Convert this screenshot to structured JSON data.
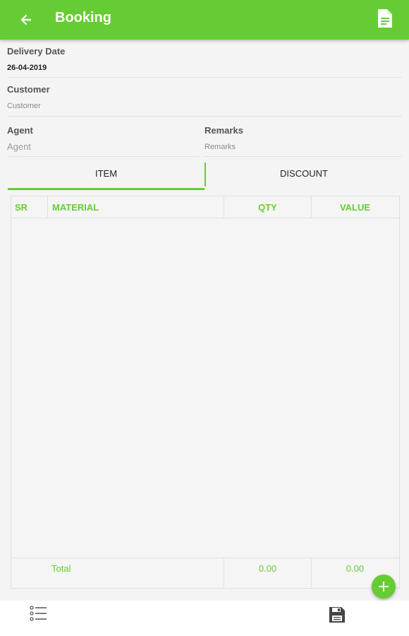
{
  "appbar": {
    "title": "Booking",
    "back_icon": "arrow-left-icon",
    "action_icon": "document-icon",
    "color": "#66cc33"
  },
  "form": {
    "delivery_date_label": "Delivery Date",
    "delivery_date_value": "26-04-2019",
    "customer_label": "Customer",
    "customer_placeholder": "Customer",
    "agent_label": "Agent",
    "agent_placeholder": "Agent",
    "remarks_label": "Remarks",
    "remarks_placeholder": "Remarks"
  },
  "tabs": [
    {
      "label": "ITEM",
      "active": true
    },
    {
      "label": "DISCOUNT",
      "active": false
    }
  ],
  "table": {
    "columns": [
      "SR",
      "MATERIAL",
      "QTY",
      "VALUE"
    ],
    "rows": [],
    "footer": {
      "label": "Total",
      "qty": "0.00",
      "value": "0.00"
    }
  },
  "fab": {
    "icon": "plus-icon"
  },
  "bottombar": {
    "left_icon": "list-icon",
    "right_icon": "save-icon"
  }
}
